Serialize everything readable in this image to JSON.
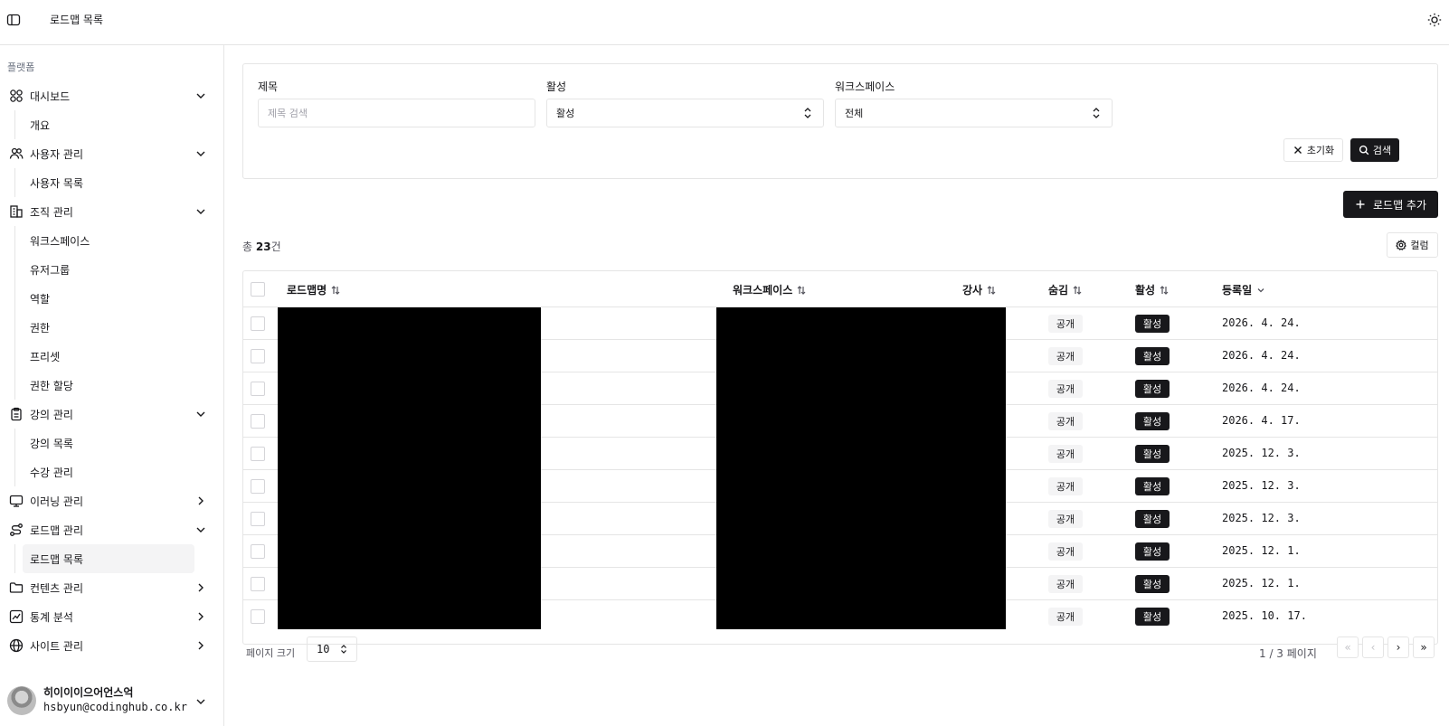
{
  "header": {
    "title": "로드맵 목록"
  },
  "sidebar": {
    "group_label": "플랫폼",
    "sections": [
      {
        "label": "대시보드",
        "icon": "grid-icon",
        "expanded": true,
        "items": [
          "개요"
        ]
      },
      {
        "label": "사용자 관리",
        "icon": "users-icon",
        "expanded": true,
        "items": [
          "사용자 목록"
        ]
      },
      {
        "label": "조직 관리",
        "icon": "building-icon",
        "expanded": true,
        "items": [
          "워크스페이스",
          "유저그룹",
          "역할",
          "권한",
          "프리셋",
          "권한 할당"
        ]
      },
      {
        "label": "강의 관리",
        "icon": "clipboard-icon",
        "expanded": true,
        "items": [
          "강의 목록",
          "수강 관리"
        ]
      },
      {
        "label": "이러닝 관리",
        "icon": "monitor-icon",
        "expanded": false,
        "items": []
      },
      {
        "label": "로드맵 관리",
        "icon": "route-icon",
        "expanded": true,
        "items": [
          "로드맵 목록"
        ]
      },
      {
        "label": "컨텐츠 관리",
        "icon": "folder-icon",
        "expanded": false,
        "items": []
      },
      {
        "label": "통계 분석",
        "icon": "chart-icon",
        "expanded": false,
        "items": []
      },
      {
        "label": "사이트 관리",
        "icon": "globe-icon",
        "expanded": false,
        "items": []
      }
    ],
    "active_item": "로드맵 목록",
    "user": {
      "name": "히이이이으어언스억",
      "email": "hsbyun@codinghub.co.kr"
    }
  },
  "filters": {
    "title_label": "제목",
    "title_placeholder": "제목 검색",
    "active_label": "활성",
    "active_value": "활성",
    "workspace_label": "워크스페이스",
    "workspace_value": "전체",
    "reset_label": "초기화",
    "search_label": "검색"
  },
  "toolbar": {
    "add_label": "로드맵 추가",
    "columns_label": "컬럼"
  },
  "summary": {
    "prefix": "총 ",
    "count": "23",
    "suffix": "건"
  },
  "table": {
    "columns": [
      "로드맵명",
      "워크스페이스",
      "강사",
      "숨김",
      "활성",
      "등록일"
    ],
    "rows": [
      {
        "hidden": "공개",
        "active": "활성",
        "date": "2026. 4. 24."
      },
      {
        "hidden": "공개",
        "active": "활성",
        "date": "2026. 4. 24."
      },
      {
        "hidden": "공개",
        "active": "활성",
        "date": "2026. 4. 24."
      },
      {
        "hidden": "공개",
        "active": "활성",
        "date": "2026. 4. 17."
      },
      {
        "hidden": "공개",
        "active": "활성",
        "date": "2025. 12. 3."
      },
      {
        "hidden": "공개",
        "active": "활성",
        "date": "2025. 12. 3."
      },
      {
        "hidden": "공개",
        "active": "활성",
        "date": "2025. 12. 3."
      },
      {
        "hidden": "공개",
        "active": "활성",
        "date": "2025. 12. 1."
      },
      {
        "hidden": "공개",
        "active": "활성",
        "date": "2025. 12. 1."
      },
      {
        "hidden": "공개",
        "active": "활성",
        "date": "2025. 10. 17."
      }
    ]
  },
  "pagination": {
    "size_label": "페이지 크기",
    "size_value": "10",
    "info": "1 / 3 페이지",
    "first": "«",
    "prev": "‹",
    "next": "›",
    "last": "»"
  },
  "colors": {
    "accent": "#18181b",
    "border": "#e5e5e5",
    "muted_bg": "#f4f4f5",
    "active_nav_bg": "#f4f4f5"
  }
}
